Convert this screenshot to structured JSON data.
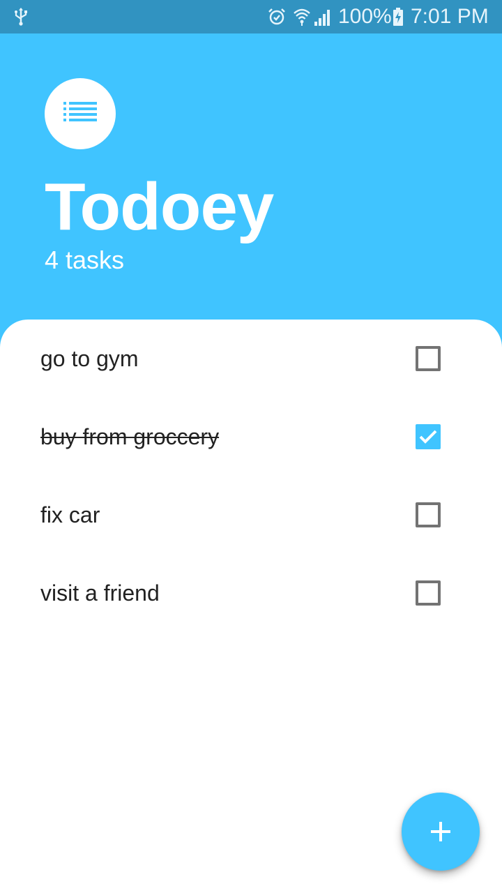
{
  "status_bar": {
    "battery_percent": "100%",
    "time": "7:01 PM",
    "icons": [
      "usb-icon",
      "alarm-icon",
      "wifi-icon",
      "signal-icon",
      "battery-charging-icon"
    ]
  },
  "header": {
    "logo_icon": "list-icon",
    "title": "Todoey",
    "task_count": "4 tasks"
  },
  "tasks": [
    {
      "title": "go to gym",
      "done": false
    },
    {
      "title": "buy from groccery",
      "done": true
    },
    {
      "title": "fix car",
      "done": false
    },
    {
      "title": "visit a friend",
      "done": false
    }
  ],
  "fab": {
    "icon": "add-icon"
  },
  "colors": {
    "accent": "#40C4FF",
    "status_bar": "#3193C1",
    "text": "#212121",
    "checkbox_border": "#737373"
  }
}
